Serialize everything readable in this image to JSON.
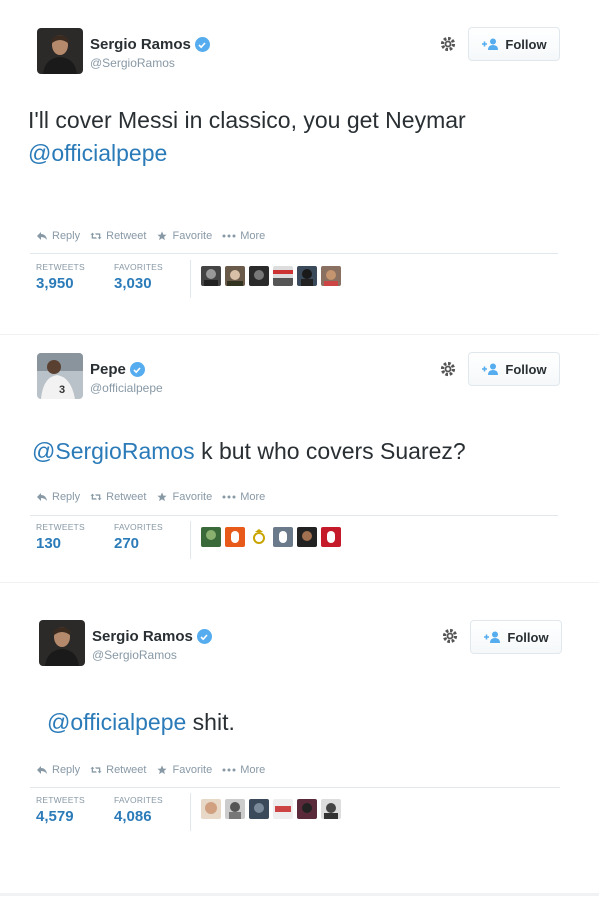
{
  "tweets": [
    {
      "name": "Sergio Ramos",
      "handle": "@SergioRamos",
      "follow_label": "Follow",
      "text_plain": "I'll cover Messi in classico, you get Neymar",
      "text_mention": "@officialpepe",
      "actions": {
        "reply": "Reply",
        "retweet": "Retweet",
        "favorite": "Favorite",
        "more": "More"
      },
      "stats": {
        "retweets_label": "RETWEETS",
        "retweets": "3,950",
        "favorites_label": "FAVORITES",
        "favorites": "3,030"
      }
    },
    {
      "name": "Pepe",
      "handle": "@officialpepe",
      "follow_label": "Follow",
      "text_mention": "@SergioRamos",
      "text_plain": " k but who covers Suarez?",
      "actions": {
        "reply": "Reply",
        "retweet": "Retweet",
        "favorite": "Favorite",
        "more": "More"
      },
      "stats": {
        "retweets_label": "RETWEETS",
        "retweets": "130",
        "favorites_label": "FAVORITES",
        "favorites": "270"
      }
    },
    {
      "name": "Sergio Ramos",
      "handle": "@SergioRamos",
      "follow_label": "Follow",
      "text_mention": "@officialpepe",
      "text_plain": " shit.",
      "actions": {
        "reply": "Reply",
        "retweet": "Retweet",
        "favorite": "Favorite",
        "more": "More"
      },
      "stats": {
        "retweets_label": "RETWEETS",
        "retweets": "4,579",
        "favorites_label": "FAVORITES",
        "favorites": "4,086"
      }
    }
  ],
  "colors": {
    "link": "#2b7bb9",
    "verified": "#55acee",
    "muted": "#8899a6",
    "text": "#292f33"
  },
  "icons": [
    "verified-badge-icon",
    "gear-icon",
    "follow-person-plus-icon",
    "reply-icon",
    "retweet-icon",
    "favorite-star-icon",
    "more-dots-icon"
  ]
}
